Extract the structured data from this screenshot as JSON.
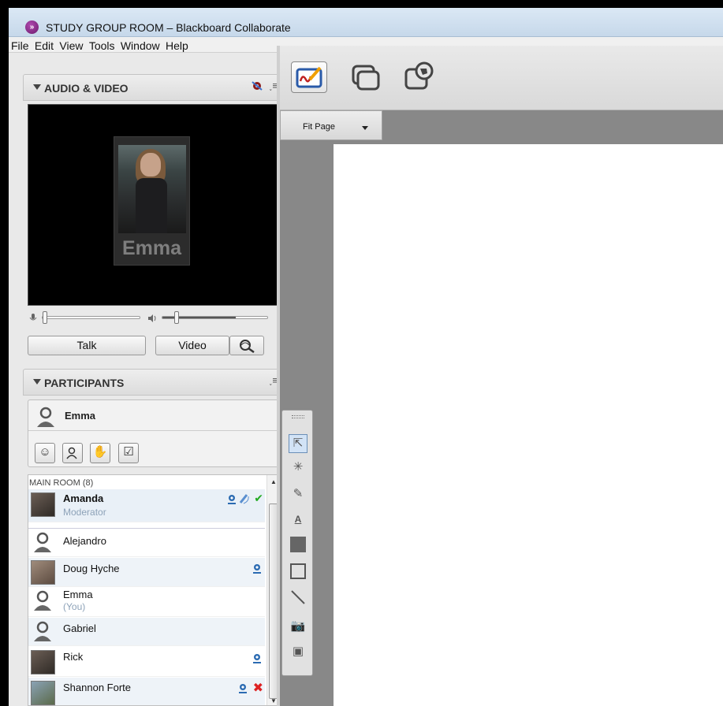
{
  "window": {
    "title": "STUDY GROUP ROOM – Blackboard Collaborate"
  },
  "menu": [
    "File",
    "Edit",
    "View",
    "Tools",
    "Window",
    "Help"
  ],
  "audio_video": {
    "title": "AUDIO & VIDEO",
    "menu_icon": "panel-menu-icon",
    "video_name": "Emma",
    "talk_label": "Talk",
    "video_label": "Video"
  },
  "participants": {
    "title": "PARTICIPANTS",
    "me_name": "Emma",
    "section_label": "MAIN ROOM (8)",
    "list": [
      {
        "name": "Amanda",
        "sub": "Moderator",
        "avatar": "photo"
      },
      {
        "name": "Alejandro",
        "sub": "",
        "avatar": "default"
      },
      {
        "name": "Doug Hyche",
        "sub": "",
        "avatar": "photo"
      },
      {
        "name": "Emma",
        "sub": "(You)",
        "avatar": "default"
      },
      {
        "name": "Gabriel",
        "sub": "",
        "avatar": "default"
      },
      {
        "name": "Rick",
        "sub": "",
        "avatar": "photo"
      },
      {
        "name": "Shannon Forte",
        "sub": "",
        "avatar": "photo"
      }
    ]
  },
  "content": {
    "fit_page_label": "Fit Page"
  },
  "colors": {
    "accent_purple": "#7a2a7a",
    "check_green": "#22aa22",
    "cross_red": "#dd2222",
    "selection_blue": "#2255aa"
  }
}
